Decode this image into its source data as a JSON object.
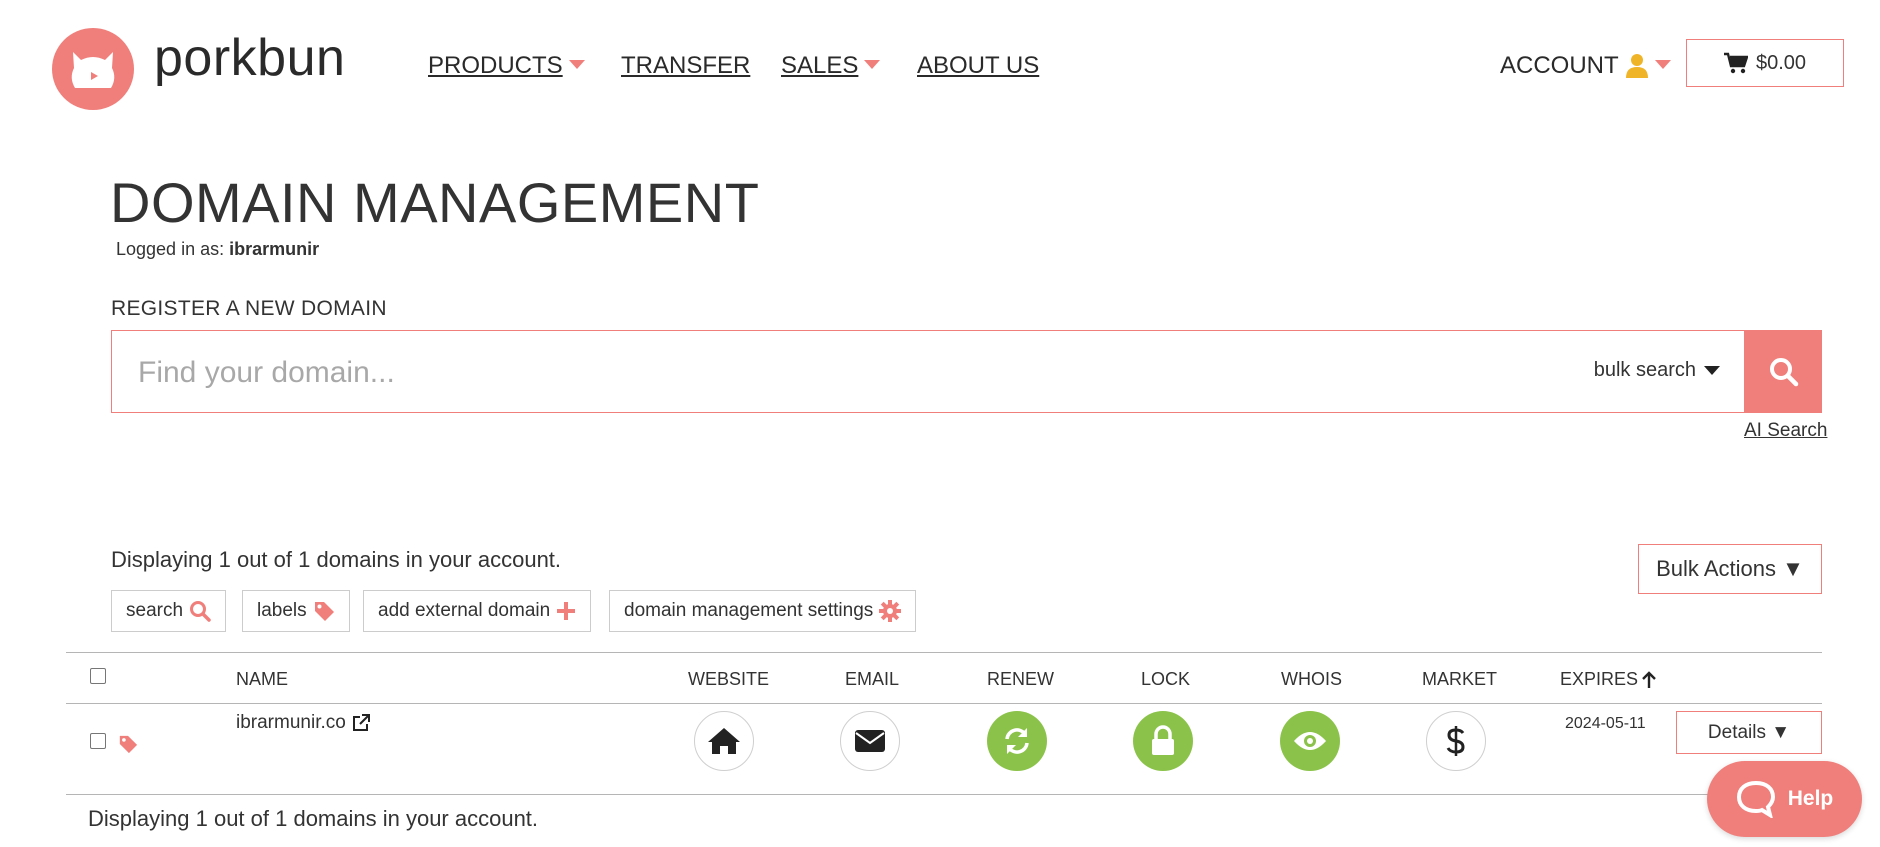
{
  "header": {
    "brand": "porkbun",
    "nav": [
      {
        "label": "PRODUCTS",
        "has_caret": true
      },
      {
        "label": "TRANSFER",
        "has_caret": false
      },
      {
        "label": "SALES",
        "has_caret": true
      },
      {
        "label": "ABOUT US",
        "has_caret": false
      }
    ],
    "account_label": "ACCOUNT",
    "cart_total": "$0.00"
  },
  "page": {
    "title": "DOMAIN MANAGEMENT",
    "logged_in_prefix": "Logged in as:",
    "username": "ibrarmunir"
  },
  "register": {
    "label": "REGISTER A NEW DOMAIN",
    "placeholder": "Find your domain...",
    "bulk_search_label": "bulk search",
    "ai_search_label": "AI Search"
  },
  "domains": {
    "display_text": "Displaying 1 out of 1 domains in your account.",
    "bulk_actions_label": "Bulk Actions ▼",
    "tools": [
      {
        "label": "search",
        "icon": "search-icon"
      },
      {
        "label": "labels",
        "icon": "tag-icon"
      },
      {
        "label": "add external domain",
        "icon": "plus-icon"
      },
      {
        "label": "domain management settings",
        "icon": "gear-icon"
      }
    ],
    "columns": [
      "NAME",
      "WEBSITE",
      "EMAIL",
      "RENEW",
      "LOCK",
      "WHOIS",
      "MARKET",
      "EXPIRES"
    ],
    "rows": [
      {
        "name": "ibrarmunir.co",
        "expires": "2024-05-11",
        "details_label": "Details ▼",
        "website_icon": "home-icon",
        "email_icon": "envelope-icon",
        "renew_icon": "sync-icon",
        "renew_status": "enabled",
        "lock_icon": "lock-icon",
        "lock_status": "locked",
        "whois_icon": "eye-icon",
        "whois_status": "enabled",
        "market_icon": "dollar-icon"
      }
    ],
    "bottom_display_text": "Displaying 1 out of 1 domains in your account."
  },
  "help": {
    "label": "Help"
  },
  "colors": {
    "brand": "#f07f7b",
    "status_green": "#8bc34a",
    "account_icon": "#f0b429"
  }
}
